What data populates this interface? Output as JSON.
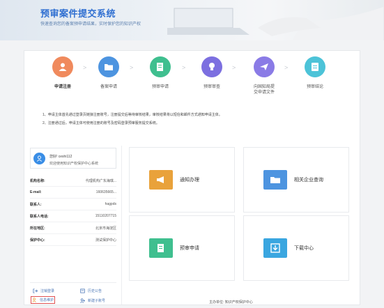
{
  "banner": {
    "title": "预审案件提交系统",
    "subtitle": "快速查询您的备案预申请结果，实时保护您的知识产权"
  },
  "steps": [
    {
      "label": "申请注册",
      "color": "#f08a5d"
    },
    {
      "label": "备案申请",
      "color": "#4d94e0"
    },
    {
      "label": "预审申请",
      "color": "#3fbf8f"
    },
    {
      "label": "预审审查",
      "color": "#7c6fe0"
    },
    {
      "label_line1": "向国知局提",
      "label_line2": "交申请文件",
      "color": "#8a7be6"
    },
    {
      "label": "预审结论",
      "color": "#4cc3d8"
    }
  ],
  "notes": [
    "1、申请主体首先通过登录页链接注册账号，注册提交后等待审核结果，审核结果将以短信和邮件方式通知申请主体。",
    "2、注册通过后，申请主体可使用注册的账号及密码登录预审服务提交系统。"
  ],
  "user": {
    "greeting": "您好! ceshi112",
    "welcome": "欢迎使用知识产权保护中心系统",
    "fields": [
      {
        "key": "机构名称:",
        "value": "代理机构广东海琪..."
      },
      {
        "key": "E-mail:",
        "value": "160635665..."
      },
      {
        "key": "联系人:",
        "value": "hagpds"
      },
      {
        "key": "联系人电话:",
        "value": "15110207715"
      },
      {
        "key": "所在地区:",
        "value": "北京市海淀区"
      },
      {
        "key": "保护中心:",
        "value": "测试保护中心"
      }
    ],
    "links": {
      "logout": "注销登录",
      "history": "历史公告",
      "info": "信息维护",
      "new_sub": "新建子账号"
    }
  },
  "tiles": {
    "notice": {
      "label": "通知办理",
      "color": "#e9a23b"
    },
    "company": {
      "label": "相关企业查询",
      "color": "#4d94e0"
    },
    "prereview": {
      "label": "预审申请",
      "color": "#3fbf8f"
    },
    "download": {
      "label": "下载中心",
      "color": "#3aa6e0"
    }
  },
  "footer": "主办单位: 知识产权保护中心"
}
